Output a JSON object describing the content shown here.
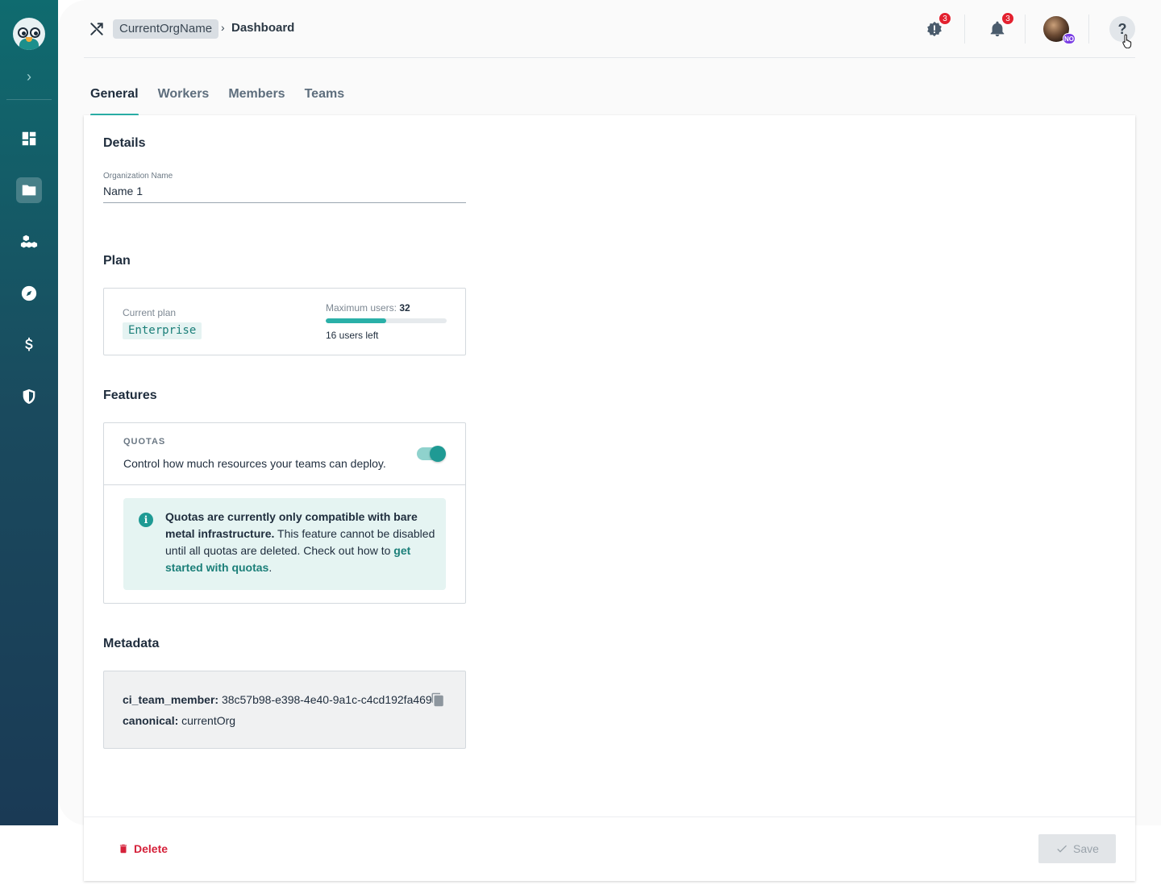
{
  "sidebar": {
    "items": [
      {
        "icon": "dashboard-icon",
        "active": false
      },
      {
        "icon": "folder-icon",
        "active": true
      },
      {
        "icon": "cubes-icon",
        "active": false
      },
      {
        "icon": "compass-icon",
        "active": false
      },
      {
        "icon": "dollar-icon",
        "active": false
      },
      {
        "icon": "shield-icon",
        "active": false
      }
    ]
  },
  "header": {
    "org_name": "CurrentOrgName",
    "separator": "›",
    "current_page": "Dashboard",
    "alerts_count": "3",
    "notifications_count": "3",
    "avatar_initials": "NO",
    "help_label": "?"
  },
  "tabs": [
    {
      "label": "General",
      "active": true
    },
    {
      "label": "Workers",
      "active": false
    },
    {
      "label": "Members",
      "active": false
    },
    {
      "label": "Teams",
      "active": false
    }
  ],
  "details": {
    "title": "Details",
    "org_name_label": "Organization Name",
    "org_name_value": "Name 1"
  },
  "plan": {
    "title": "Plan",
    "current_plan_label": "Current plan",
    "current_plan_value": "Enterprise",
    "max_users_label": "Maximum users:",
    "max_users_value": "32",
    "users_used_fraction": 0.5,
    "users_left": "16 users left"
  },
  "features": {
    "title": "Features",
    "quotas_tag": "QUOTAS",
    "quotas_desc": "Control how much resources your teams can deploy.",
    "quotas_enabled": true,
    "info_bold": "Quotas are currently only compatible with bare metal infrastructure.",
    "info_text": " This feature cannot be disabled until all quotas are deleted. Check out how to ",
    "info_link": "get started with quotas",
    "info_end": "."
  },
  "metadata": {
    "title": "Metadata",
    "rows": [
      {
        "key": "ci_team_member:",
        "value": "38c57b98-e398-4e40-9a1c-c4cd192fa469"
      },
      {
        "key": "canonical:",
        "value": "currentOrg"
      }
    ]
  },
  "footer": {
    "delete_label": "Delete",
    "save_label": "Save"
  },
  "colors": {
    "accent": "#2ab0a8",
    "danger": "#d5213a",
    "badge": "#e3212f"
  }
}
